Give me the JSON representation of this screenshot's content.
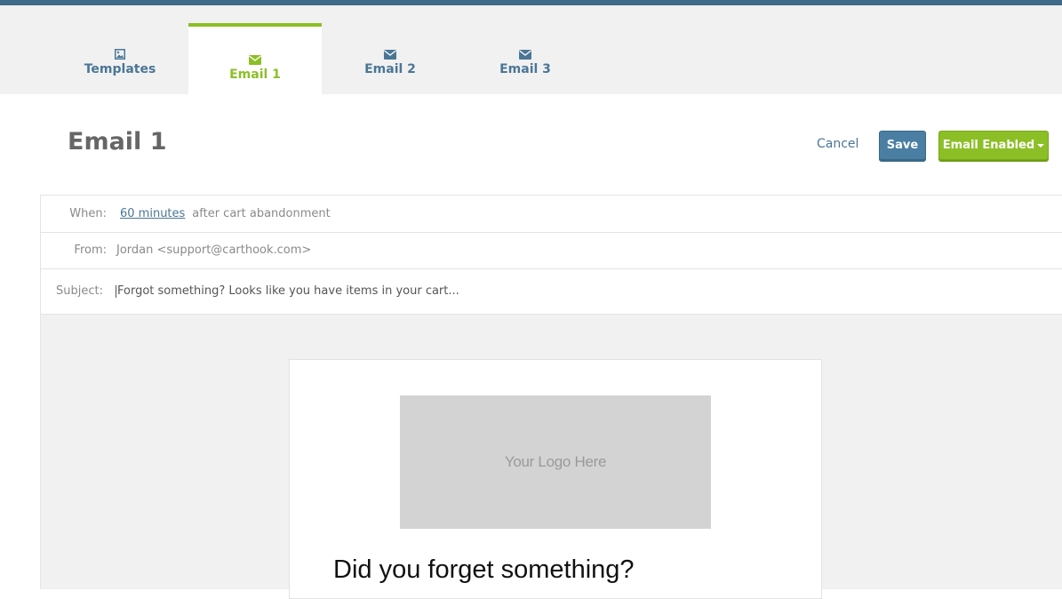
{
  "colors": {
    "topbar": "#3f6a8a",
    "tab_inactive_text": "#4a7696",
    "tab_active_text": "#8cbf26",
    "save_button": "#4a7fa3",
    "enabled_button": "#8cbf26",
    "preview_background": "#f1f1f1",
    "logo_placeholder": "#d3d3d3"
  },
  "tabs": [
    {
      "label": "Templates",
      "icon": "image-icon",
      "active": false
    },
    {
      "label": "Email 1",
      "icon": "envelope-icon",
      "active": true
    },
    {
      "label": "Email 2",
      "icon": "envelope-icon",
      "active": false
    },
    {
      "label": "Email 3",
      "icon": "envelope-icon",
      "active": false
    }
  ],
  "header": {
    "title": "Email 1",
    "cancel_label": "Cancel",
    "save_label": "Save",
    "status_label": "Email Enabled"
  },
  "meta": {
    "when_label": "When:",
    "when_value": "60 minutes",
    "when_suffix": "after cart abandonment",
    "from_label": "From:",
    "from_value": "Jordan <support@carthook.com>",
    "subject_label": "Subject:",
    "subject_value": "Forgot something? Looks like you have items in your cart..."
  },
  "preview": {
    "logo_placeholder": "Your Logo Here",
    "heading": "Did you forget something?"
  }
}
